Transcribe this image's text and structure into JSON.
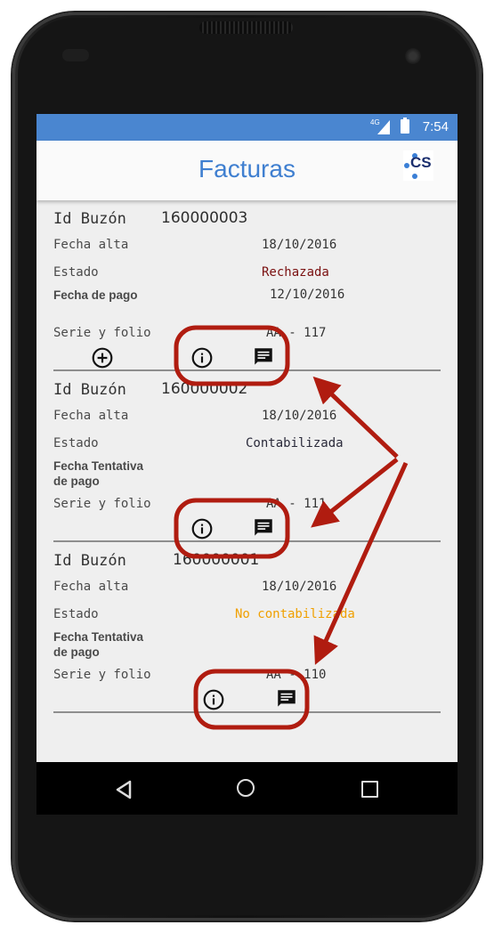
{
  "status_bar": {
    "network": "4G",
    "time": "7:54"
  },
  "app_bar": {
    "title": "Facturas",
    "logo_text": "CS"
  },
  "invoices": [
    {
      "id_label": "Id Buzón",
      "id_value": "160000003",
      "fecha_alta_label": "Fecha alta",
      "fecha_alta_value": "18/10/2016",
      "estado_label": "Estado",
      "estado_value": "Rechazada",
      "estado_color": "#7a1010",
      "fecha_pago_label": "Fecha de pago",
      "fecha_pago_value": "12/10/2016",
      "serie_label": "Serie y folio",
      "serie_value": "AA - 117"
    },
    {
      "id_label": "Id Buzón",
      "id_value": "160000002",
      "fecha_alta_label": "Fecha alta",
      "fecha_alta_value": "18/10/2016",
      "estado_label": "Estado",
      "estado_value": "Contabilizada",
      "estado_color": "#2a2a3a",
      "fecha_pago_label": "Fecha Tentativa de pago",
      "fecha_pago_value": "",
      "serie_label": "Serie y folio",
      "serie_value": "AA - 111"
    },
    {
      "id_label": "Id Buzón",
      "id_value": "160000001",
      "fecha_alta_label": "Fecha alta",
      "fecha_alta_value": "18/10/2016",
      "estado_label": "Estado",
      "estado_value": "No contabilizada",
      "estado_color": "#f0a000",
      "fecha_pago_label": "Fecha Tentativa de pago",
      "fecha_pago_value": "",
      "serie_label": "Serie y folio",
      "serie_value": "AA - 110"
    }
  ],
  "icons": {
    "add": "add-circle-icon",
    "info": "info-icon",
    "comment": "comment-icon",
    "back": "back-icon",
    "home": "home-icon",
    "recent": "recent-apps-icon"
  },
  "colors": {
    "status_bar": "#4a86d0",
    "title": "#3f7fd0",
    "annotation": "#b01c10"
  }
}
